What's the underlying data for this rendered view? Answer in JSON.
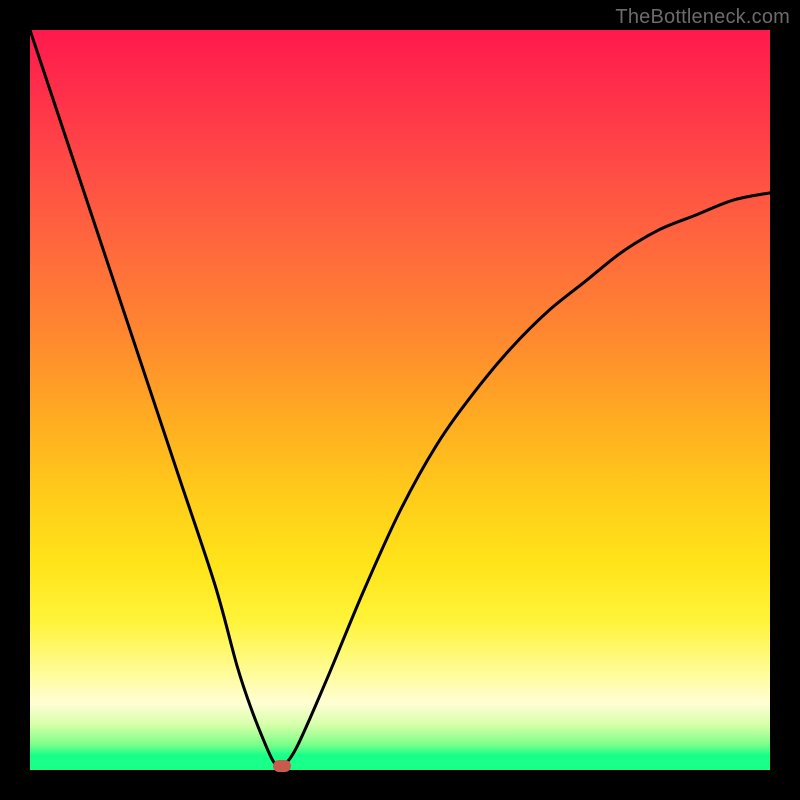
{
  "watermark": "TheBottleneck.com",
  "chart_data": {
    "type": "line",
    "title": "",
    "xlabel": "",
    "ylabel": "",
    "xlim": [
      0,
      100
    ],
    "ylim": [
      0,
      100
    ],
    "grid": false,
    "legend": false,
    "series": [
      {
        "name": "bottleneck-curve",
        "x": [
          0,
          5,
          10,
          15,
          20,
          25,
          28,
          30,
          32,
          33,
          34,
          36,
          40,
          45,
          50,
          55,
          60,
          65,
          70,
          75,
          80,
          85,
          90,
          95,
          100
        ],
        "y": [
          100,
          85,
          70,
          55,
          40,
          25,
          14,
          8,
          3,
          1,
          0.5,
          3,
          12,
          24,
          35,
          44,
          51,
          57,
          62,
          66,
          70,
          73,
          75,
          77,
          78
        ]
      }
    ],
    "marker": {
      "x": 34,
      "y": 0.5
    },
    "gradient_stops": [
      {
        "pos": 0,
        "color": "#ff1a4d"
      },
      {
        "pos": 50,
        "color": "#ffaa22"
      },
      {
        "pos": 80,
        "color": "#fff43a"
      },
      {
        "pos": 97,
        "color": "#18ff8a"
      },
      {
        "pos": 100,
        "color": "#18ff8a"
      }
    ]
  }
}
